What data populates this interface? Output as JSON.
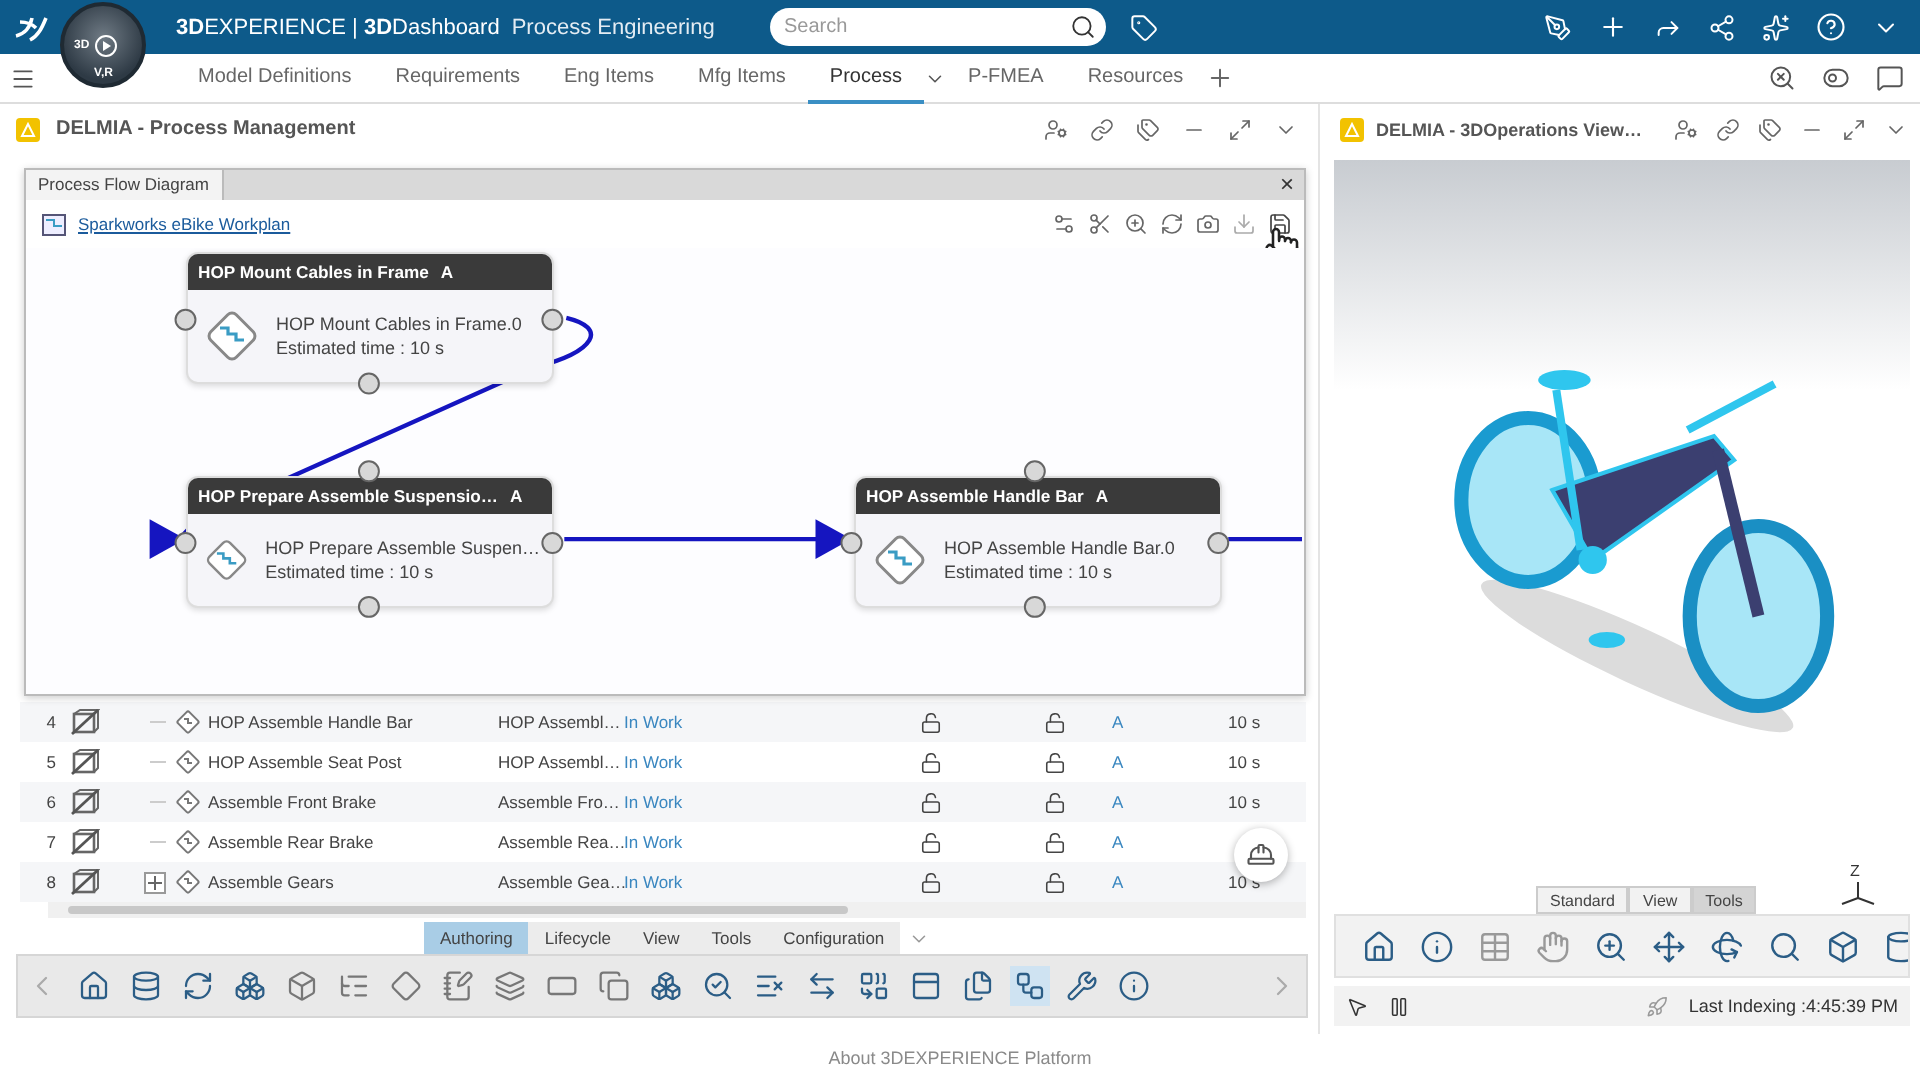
{
  "topbar": {
    "brand": "**3D**EXPERIENCE | **3D**Dashboard",
    "app": "Process Engineering",
    "compass": {
      "top": "3D",
      "bottom": "V,R"
    },
    "search": {
      "placeholder": "Search"
    }
  },
  "tabs": [
    {
      "label": "Model Definitions",
      "selected": false
    },
    {
      "label": "Requirements",
      "selected": false
    },
    {
      "label": "Eng Items",
      "selected": false
    },
    {
      "label": "Mfg Items",
      "selected": false
    },
    {
      "label": "Process",
      "selected": true
    },
    {
      "label": "P-FMEA",
      "selected": false
    },
    {
      "label": "Resources",
      "selected": false
    }
  ],
  "process_panel": {
    "title": "DELMIA - Process Management",
    "diagram": {
      "title": "Process Flow Diagram",
      "close": "×",
      "workplan": "Sparkworks eBike Workplan",
      "nodes": [
        {
          "title": "HOP Mount Cables in Frame",
          "revision": "A",
          "name": "HOP Mount Cables in Frame.0",
          "time": "Estimated time : 10 s"
        },
        {
          "title": "HOP Prepare Assemble Suspensio…",
          "revision": "A",
          "name": "HOP Prepare Assemble Suspen…",
          "time": "Estimated time : 10 s"
        },
        {
          "title": "HOP Assemble Handle Bar",
          "revision": "A",
          "name": "HOP Assemble Handle Bar.0",
          "time": "Estimated time : 10 s"
        }
      ]
    },
    "table": {
      "rows": [
        {
          "index": "4",
          "expandable": false,
          "name": "HOP Assemble Handle Bar",
          "title": "HOP Assembl…",
          "state": "In Work",
          "revision": "A",
          "time": "10 s"
        },
        {
          "index": "5",
          "expandable": false,
          "name": "HOP Assemble Seat Post",
          "title": "HOP Assembl…",
          "state": "In Work",
          "revision": "A",
          "time": "10 s"
        },
        {
          "index": "6",
          "expandable": false,
          "name": "Assemble Front Brake",
          "title": "Assemble Fro…",
          "state": "In Work",
          "revision": "A",
          "time": "10 s"
        },
        {
          "index": "7",
          "expandable": false,
          "name": "Assemble Rear Brake",
          "title": "Assemble Rea…",
          "state": "In Work",
          "revision": "A"
        },
        {
          "index": "8",
          "expandable": true,
          "name": "Assemble Gears",
          "title": "Assemble Gea…",
          "state": "In Work",
          "revision": "A",
          "time": "10 s"
        }
      ]
    },
    "toolbar_tabs": [
      {
        "label": "Authoring",
        "selected": true
      },
      {
        "label": "Lifecycle",
        "selected": false
      },
      {
        "label": "View",
        "selected": false
      },
      {
        "label": "Tools",
        "selected": false
      },
      {
        "label": "Configuration",
        "selected": false
      }
    ]
  },
  "viewer_panel": {
    "title": "DELMIA - 3DOperations View…",
    "tabs": [
      {
        "label": "Standard",
        "selected": false
      },
      {
        "label": "View",
        "selected": false
      },
      {
        "label": "Tools",
        "selected": true
      }
    ],
    "axis_label": "Z",
    "status": "Last Indexing :4:45:39 PM"
  },
  "footer": "About 3DEXPERIENCE Platform"
}
